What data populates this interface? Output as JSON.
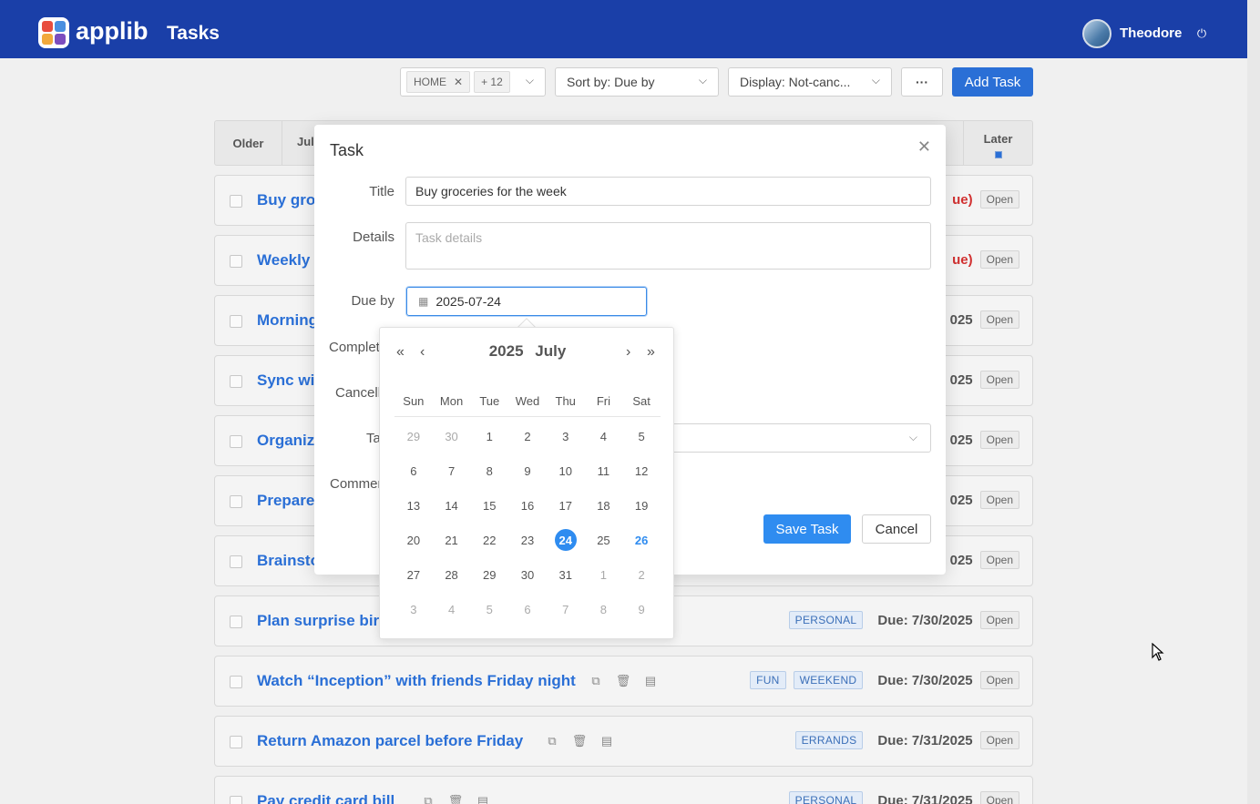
{
  "header": {
    "brand": "applib",
    "page_title": "Tasks",
    "user_name": "Theodore",
    "logo_colors": [
      "#e84d3d",
      "#4a8fe0",
      "#f2a93b",
      "#7c4dbf"
    ]
  },
  "toolbar": {
    "filter_tag": "HOME",
    "filter_more": "+ 12",
    "sort_label": "Sort by: Due by",
    "display_label": "Display: Not-canc...",
    "more_label": "···",
    "add_task_label": "Add Task"
  },
  "date_strip": {
    "older": "Older",
    "first_month": "Jul",
    "later": "Later"
  },
  "tasks": [
    {
      "title": "Buy groc",
      "due": "ue)",
      "due_overdue": true,
      "status": "Open"
    },
    {
      "title": "Weekly t",
      "due": "ue)",
      "due_overdue": true,
      "status": "Open"
    },
    {
      "title": "Morning",
      "due": "025",
      "status": "Open"
    },
    {
      "title": "Sync wit",
      "due": "025",
      "status": "Open"
    },
    {
      "title": "Organize",
      "due": "025",
      "status": "Open"
    },
    {
      "title": "Prepare",
      "due": "025",
      "status": "Open"
    },
    {
      "title": "Brainsto",
      "due": "025",
      "status": "Open"
    },
    {
      "title": "Plan surprise birtl",
      "tags": [
        "PERSONAL"
      ],
      "due": "Due: 7/30/2025",
      "status": "Open"
    },
    {
      "title": "Watch “Inception” with friends Friday night",
      "tags": [
        "FUN",
        "WEEKEND"
      ],
      "due": "Due: 7/30/2025",
      "status": "Open"
    },
    {
      "title": "Return Amazon parcel before Friday",
      "tags": [
        "ERRANDS"
      ],
      "due": "Due: 7/31/2025",
      "status": "Open"
    },
    {
      "title": "Pay credit card bill",
      "tags": [
        "PERSONAL"
      ],
      "due": "Due: 7/31/2025",
      "status": "Open"
    }
  ],
  "modal": {
    "title": "Task",
    "labels": {
      "title": "Title",
      "details": "Details",
      "due_by": "Due by",
      "completed": "Complet",
      "cancelled": "Cancell",
      "tags": "Ta",
      "comments": "Commen"
    },
    "title_value": "Buy groceries for the week",
    "details_placeholder": "Task details",
    "due_value": "2025-07-24",
    "save_label": "Save Task",
    "cancel_label": "Cancel"
  },
  "picker": {
    "year": "2025",
    "month": "July",
    "weekdays": [
      "Sun",
      "Mon",
      "Tue",
      "Wed",
      "Thu",
      "Fri",
      "Sat"
    ],
    "days": [
      {
        "d": "29",
        "m": true
      },
      {
        "d": "30",
        "m": true
      },
      {
        "d": "1"
      },
      {
        "d": "2"
      },
      {
        "d": "3"
      },
      {
        "d": "4"
      },
      {
        "d": "5"
      },
      {
        "d": "6"
      },
      {
        "d": "7"
      },
      {
        "d": "8"
      },
      {
        "d": "9"
      },
      {
        "d": "10"
      },
      {
        "d": "11"
      },
      {
        "d": "12"
      },
      {
        "d": "13"
      },
      {
        "d": "14"
      },
      {
        "d": "15"
      },
      {
        "d": "16"
      },
      {
        "d": "17"
      },
      {
        "d": "18"
      },
      {
        "d": "19"
      },
      {
        "d": "20"
      },
      {
        "d": "21"
      },
      {
        "d": "22"
      },
      {
        "d": "23"
      },
      {
        "d": "24",
        "selected": true
      },
      {
        "d": "25"
      },
      {
        "d": "26",
        "today": true
      },
      {
        "d": "27"
      },
      {
        "d": "28"
      },
      {
        "d": "29"
      },
      {
        "d": "30"
      },
      {
        "d": "31"
      },
      {
        "d": "1",
        "m": true
      },
      {
        "d": "2",
        "m": true
      },
      {
        "d": "3",
        "m": true
      },
      {
        "d": "4",
        "m": true
      },
      {
        "d": "5",
        "m": true
      },
      {
        "d": "6",
        "m": true
      },
      {
        "d": "7",
        "m": true
      },
      {
        "d": "8",
        "m": true
      },
      {
        "d": "9",
        "m": true
      }
    ]
  }
}
